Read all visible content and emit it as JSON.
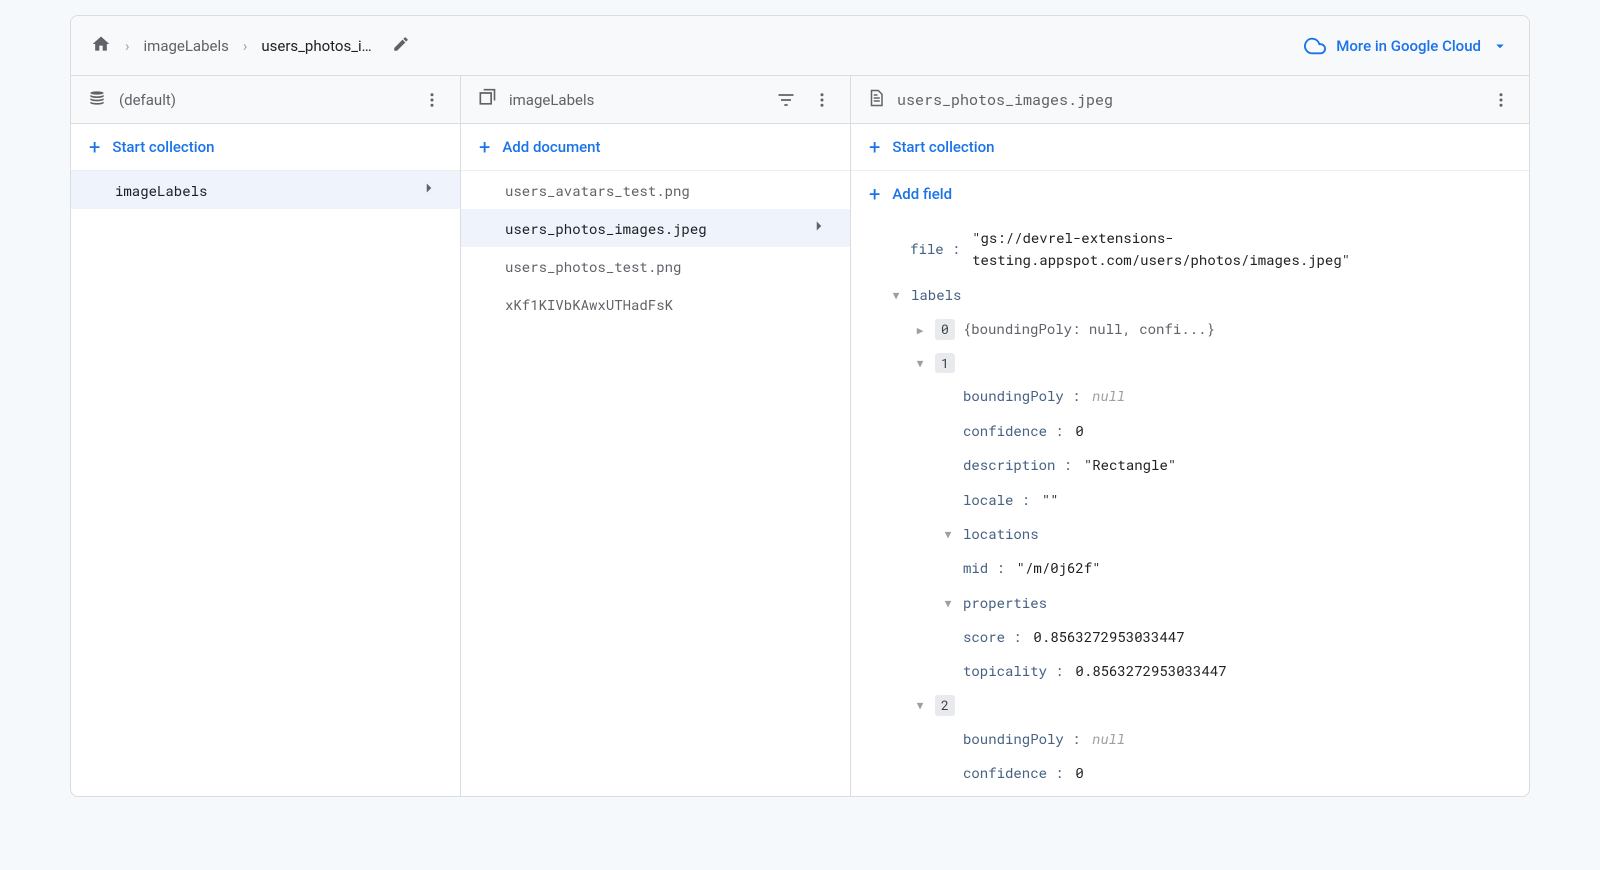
{
  "breadcrumb": {
    "item1": "imageLabels",
    "item2": "users_photos_i…"
  },
  "topbar": {
    "cloud_link": "More in Google Cloud"
  },
  "col_root": {
    "header": "(default)",
    "start_collection": "Start collection",
    "items": [
      "imageLabels"
    ]
  },
  "col_mid": {
    "header": "imageLabels",
    "add_document": "Add document",
    "items": [
      "users_avatars_test.png",
      "users_photos_images.jpeg",
      "users_photos_test.png",
      "xKf1KIVbKAwxUTHadFsK"
    ],
    "selected_index": 1
  },
  "col_doc": {
    "header": "users_photos_images.jpeg",
    "start_collection": "Start collection",
    "add_field": "Add field",
    "fields": {
      "file_key": "file",
      "file_val": "\"gs://devrel-extensions-testing.appspot.com/users/photos/images.jpeg\"",
      "labels_key": "labels",
      "idx0": "0",
      "idx0_preview": "{boundingPoly: null, confi...}",
      "idx1": "1",
      "l1_boundingPoly_key": "boundingPoly",
      "l1_boundingPoly_val": "null",
      "l1_confidence_key": "confidence",
      "l1_confidence_val": "0",
      "l1_description_key": "description",
      "l1_description_val": "\"Rectangle\"",
      "l1_locale_key": "locale",
      "l1_locale_val": "\"\"",
      "l1_locations_key": "locations",
      "l1_mid_key": "mid",
      "l1_mid_val": "\"/m/0j62f\"",
      "l1_properties_key": "properties",
      "l1_score_key": "score",
      "l1_score_val": "0.8563272953033447",
      "l1_topicality_key": "topicality",
      "l1_topicality_val": "0.8563272953033447",
      "idx2": "2",
      "l2_boundingPoly_key": "boundingPoly",
      "l2_boundingPoly_val": "null",
      "l2_confidence_key": "confidence",
      "l2_confidence_val": "0"
    }
  }
}
